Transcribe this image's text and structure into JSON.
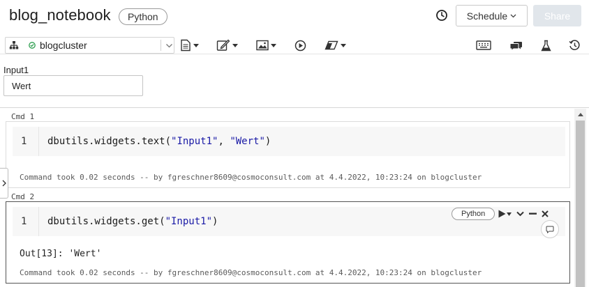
{
  "notebook": {
    "title": "blog_notebook",
    "language": "Python",
    "schedule_label": "Schedule",
    "share_label": "Share"
  },
  "toolbar": {
    "cluster_name": "blogcluster",
    "icons": [
      "file-icon",
      "edit-icon",
      "image-icon",
      "run-icon",
      "eraser-icon",
      "keyboard-icon",
      "comments-icon",
      "experiment-icon",
      "revision-history-icon"
    ]
  },
  "widget": {
    "label": "Input1",
    "value": "Wert"
  },
  "cells": [
    {
      "cmd": "Cmd 1",
      "line_no": "1",
      "code_prefix": "dbutils.widgets.text(",
      "code_arg1": "\"Input1\"",
      "code_sep": ", ",
      "code_arg2": "\"Wert\"",
      "code_suffix": ")",
      "meta": "Command took 0.02 seconds -- by fgreschner8609@cosmoconsult.com at 4.4.2022, 10:23:24 on blogcluster"
    },
    {
      "cmd": "Cmd 2",
      "line_no": "1",
      "code_prefix": "dbutils.widgets.get(",
      "code_arg1": "\"Input1\"",
      "code_suffix": ")",
      "language": "Python",
      "output": "Out[13]: 'Wert'",
      "meta": "Command took 0.02 seconds -- by fgreschner8609@cosmoconsult.com at 4.4.2022, 10:23:24 on blogcluster"
    }
  ],
  "colors": {
    "string_literal": "#1a1aa6",
    "status_ok": "#2e9e4f",
    "share_disabled": "#e1e6eb",
    "active_cell_border": "#545454"
  }
}
